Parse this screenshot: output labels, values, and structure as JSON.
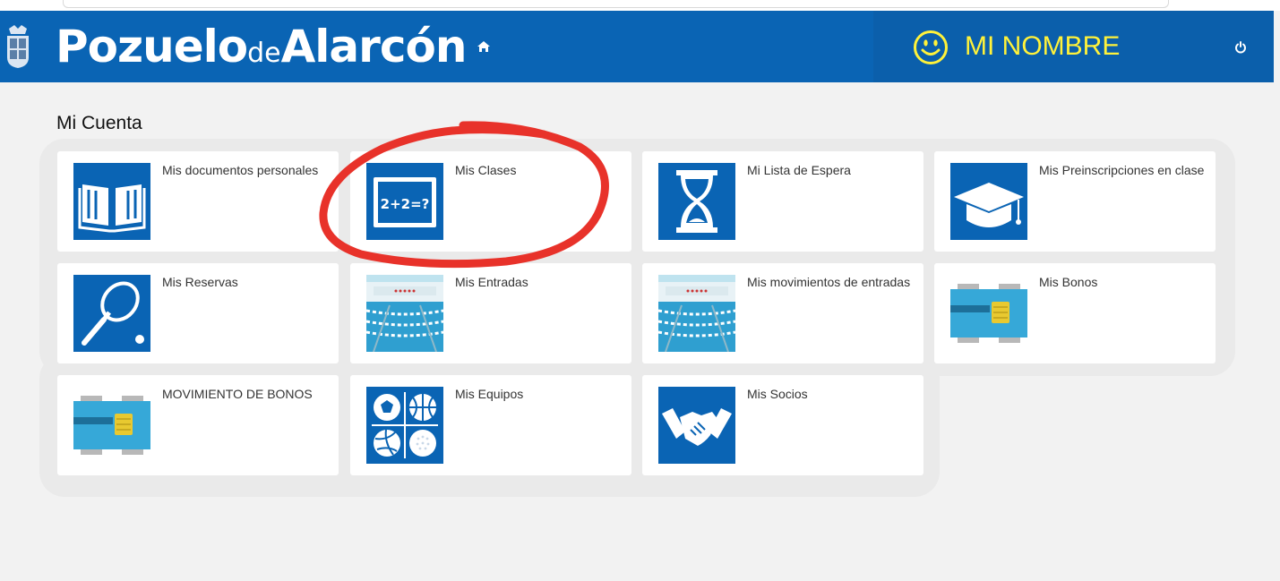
{
  "header": {
    "brand_pozuelo": "Pozuelo",
    "brand_de": "de",
    "brand_alarcon": "Alarcón",
    "user_name": "MI NOMBRE",
    "accent_yellow": "#fff23a",
    "bar_color": "#0a64b4",
    "icons": {
      "home": "home-icon",
      "smile": "smiley-icon",
      "power": "power-icon",
      "shield": "coat-of-arms-icon"
    }
  },
  "page": {
    "title": "Mi Cuenta"
  },
  "cards": [
    {
      "label": "Mis documentos personales",
      "icon": "open-book-icon"
    },
    {
      "label": "Mis Clases",
      "icon": "blackboard-icon",
      "icon_text": "2+2=?"
    },
    {
      "label": "Mi Lista de Espera",
      "icon": "hourglass-icon"
    },
    {
      "label": "Mis Preinscripciones en clase",
      "icon": "graduation-cap-icon"
    },
    {
      "label": "Mis Reservas",
      "icon": "tennis-racket-icon"
    },
    {
      "label": "Mis Entradas",
      "icon": "swimming-pool-icon"
    },
    {
      "label": "Mis movimientos de entradas",
      "icon": "swimming-pool-icon"
    },
    {
      "label": "Mis Bonos",
      "icon": "membership-card-icon"
    },
    {
      "label": "MOVIMIENTO DE BONOS",
      "icon": "membership-card-icon"
    },
    {
      "label": "Mis Equipos",
      "icon": "sports-balls-icon"
    },
    {
      "label": "Mis Socios",
      "icon": "handshake-icon"
    }
  ],
  "annotation": {
    "color": "#e8322a",
    "target": "Mis Clases"
  }
}
